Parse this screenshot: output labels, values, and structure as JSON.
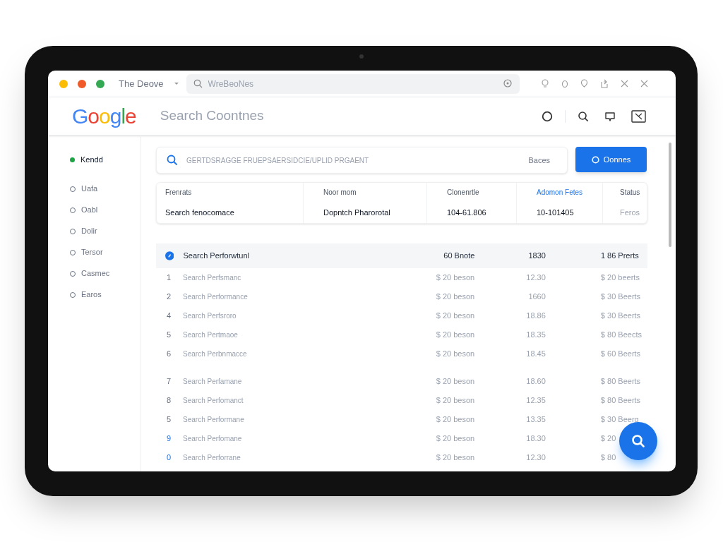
{
  "window": {
    "tab_title": "The Deove",
    "address_placeholder": "WreBeoNes"
  },
  "header": {
    "logo": [
      {
        "char": "G",
        "color": "#4285f4"
      },
      {
        "char": "o",
        "color": "#ea4335"
      },
      {
        "char": "o",
        "color": "#fbbc05"
      },
      {
        "char": "g",
        "color": "#4285f4"
      },
      {
        "char": "l",
        "color": "#34a853"
      },
      {
        "char": "e",
        "color": "#ea4335"
      }
    ],
    "title": "Search Coontnes"
  },
  "sidebar": {
    "items": [
      {
        "label": "Kendd",
        "selected": true
      },
      {
        "label": "Uafa",
        "selected": false
      },
      {
        "label": "Oabl",
        "selected": false
      },
      {
        "label": "Dolir",
        "selected": false
      },
      {
        "label": "Tersor",
        "selected": false
      },
      {
        "label": "Casmec",
        "selected": false
      },
      {
        "label": "Earos",
        "selected": false
      }
    ]
  },
  "search": {
    "placeholder": "GERTDSRAGGE FRUEPSAERSIDCIE/UPLID PRGAENT",
    "suffix": "Baces",
    "button": "Oonnes"
  },
  "summary": [
    {
      "label": "Frenrats",
      "value": "Search fenocomace",
      "selected": false
    },
    {
      "label": "Noor mom",
      "value": "Dopntch Pharorotal",
      "selected": false
    },
    {
      "label": "Clonenrtle",
      "value": "104-61.806",
      "selected": false
    },
    {
      "label": "Adomon Fetes",
      "value": "10-101405",
      "selected": true
    },
    {
      "label": "Status",
      "value": "Feros",
      "selected": false
    }
  ],
  "table": {
    "header": {
      "name": "Search Perforwtunl",
      "column_3": "60 Bnote",
      "column_4": "1830",
      "column_5": "1 86 Prerts"
    },
    "row_groups": [
      {
        "rows": [
          {
            "number": "1",
            "name": "Search Perfsmanc",
            "column_3": "$ 20 beson",
            "column_4": "12.30",
            "column_5": "$ 20 beerts",
            "marked": false
          },
          {
            "number": "2",
            "name": "Search Performance",
            "column_3": "$ 20 beson",
            "column_4": "1660",
            "column_5": "$ 30 Beerts",
            "marked": false
          },
          {
            "number": "4",
            "name": "Search Perfsroro",
            "column_3": "$ 20 beson",
            "column_4": "18.86",
            "column_5": "$ 30 Beerts",
            "marked": false
          },
          {
            "number": "5",
            "name": "Search Pertmaoe",
            "column_3": "$ 20 beson",
            "column_4": "18.35",
            "column_5": "$ 80 Beects",
            "marked": false
          },
          {
            "number": "6",
            "name": "Search Perbnmacce",
            "column_3": "$ 20 beson",
            "column_4": "18.45",
            "column_5": "$ 60 Beerts",
            "marked": false
          }
        ]
      },
      {
        "rows": [
          {
            "number": "7",
            "name": "Search Perfamane",
            "column_3": "$ 20 beson",
            "column_4": "18.60",
            "column_5": "$ 80 Beerts",
            "marked": false
          },
          {
            "number": "8",
            "name": "Search Perfomanct",
            "column_3": "$ 20 beson",
            "column_4": "12.35",
            "column_5": "$ 80 Beerts",
            "marked": false
          },
          {
            "number": "5",
            "name": "Search Performane",
            "column_3": "$ 20 beson",
            "column_4": "13.35",
            "column_5": "$ 30 Beerg",
            "marked": false
          },
          {
            "number": "9",
            "name": "Search Perfomane",
            "column_3": "$ 20 beson",
            "column_4": "18.30",
            "column_5": "$ 20",
            "marked": true
          },
          {
            "number": "0",
            "name": "Search Perforrane",
            "column_3": "$ 20 beson",
            "column_4": "12.30",
            "column_5": "$ 80",
            "marked": true
          }
        ]
      }
    ]
  }
}
